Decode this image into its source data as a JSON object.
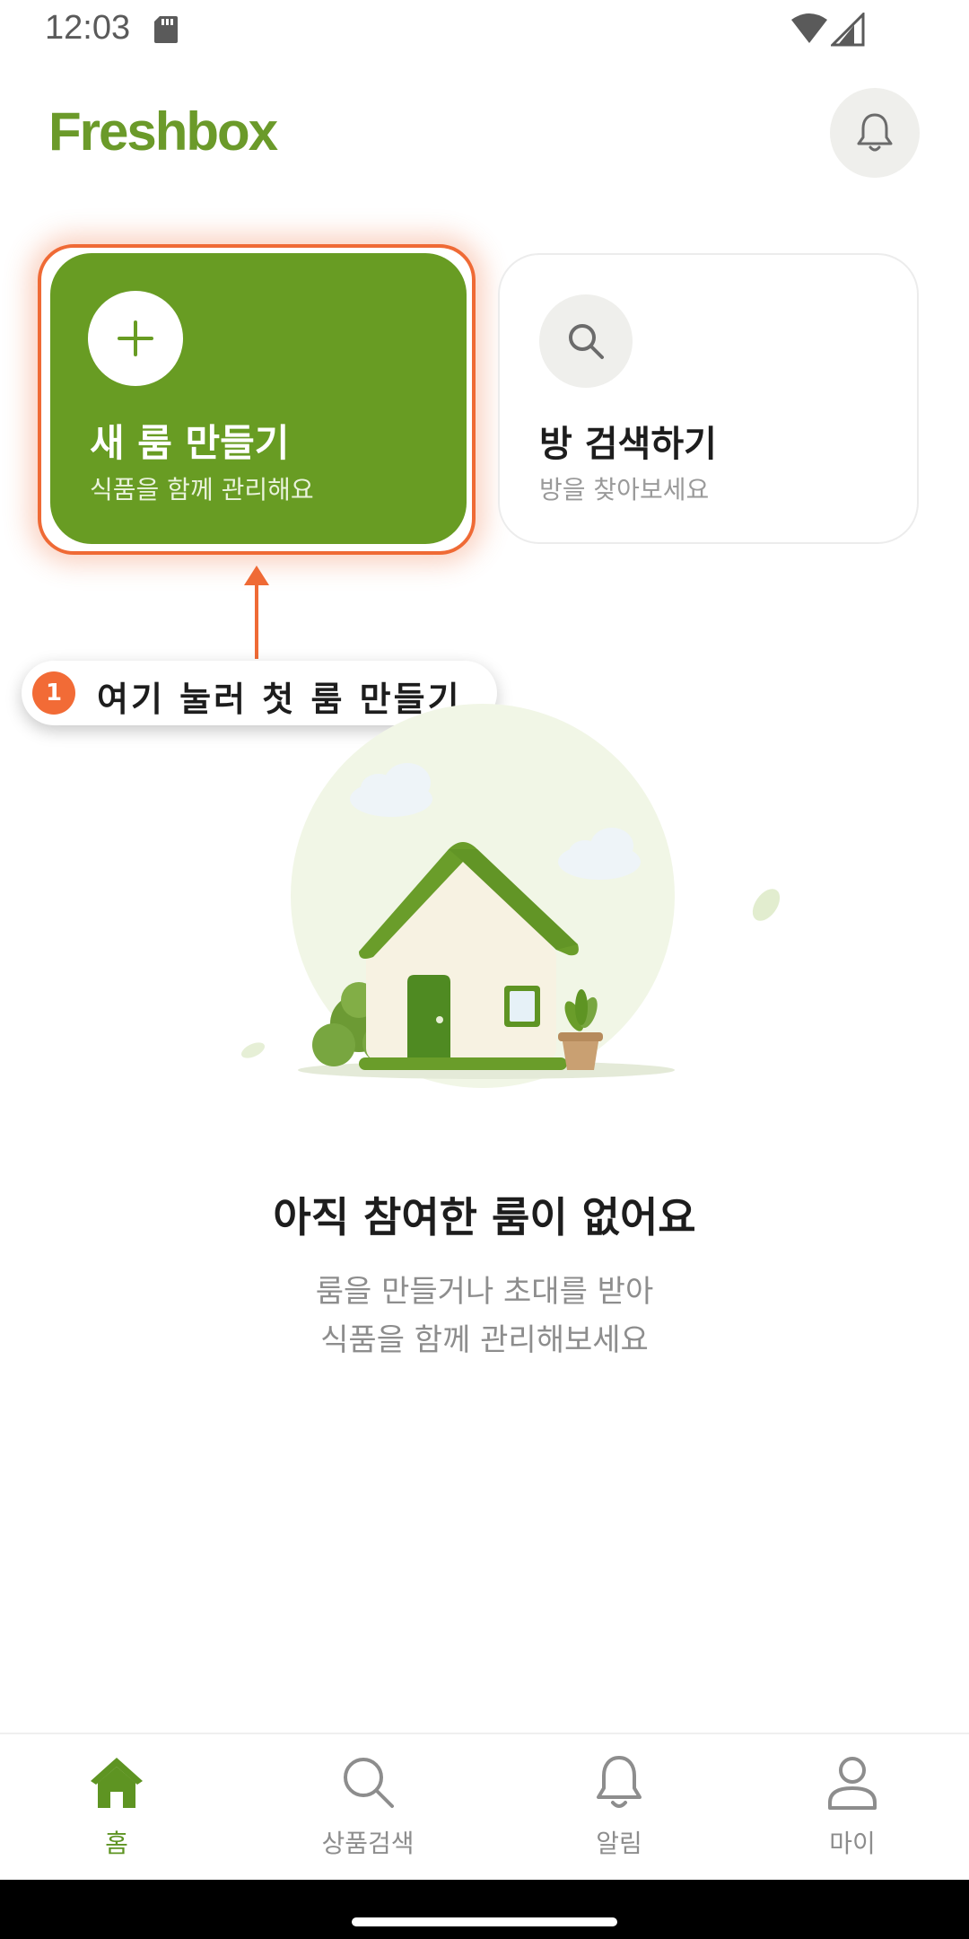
{
  "status_bar": {
    "time": "12:03",
    "icons": [
      "sd-card-icon",
      "wifi-icon",
      "signal-icon"
    ]
  },
  "header": {
    "app_name": "Freshbox",
    "notification_icon": "bell-icon"
  },
  "cards": {
    "create_room": {
      "icon": "plus-icon",
      "title": "새 룸 만들기",
      "subtitle": "식품을 함께 관리해요"
    },
    "search_room": {
      "icon": "search-icon",
      "title": "방 검색하기",
      "subtitle": "방을 찾아보세요"
    }
  },
  "tooltip": {
    "step": "1",
    "text": "여기 눌러 첫 룸 만들기"
  },
  "empty_state": {
    "title": "아직 참여한 룸이 없어요",
    "description_line1": "룸을 만들거나 초대를 받아",
    "description_line2": "식품을 함께 관리해보세요"
  },
  "bottom_nav": {
    "items": [
      {
        "label": "홈",
        "icon": "home-icon",
        "active": true
      },
      {
        "label": "상품검색",
        "icon": "search-icon",
        "active": false
      },
      {
        "label": "알림",
        "icon": "bell-icon",
        "active": false
      },
      {
        "label": "마이",
        "icon": "person-icon",
        "active": false
      }
    ]
  },
  "colors": {
    "brand_green": "#689c23",
    "highlight_orange": "#ef6a35",
    "muted_text": "#8d8d8d"
  }
}
